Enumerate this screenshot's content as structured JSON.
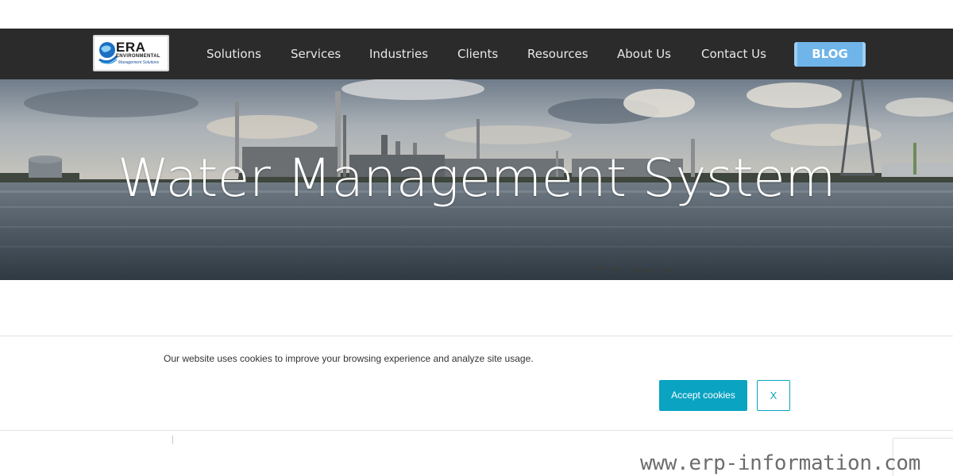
{
  "header": {
    "logo": {
      "name": "ERA",
      "line2": "ENVIRONMENTAL",
      "line3": "Management Solutions",
      "globe_icon": "globe-swoosh-icon"
    },
    "nav": [
      {
        "label": "Solutions"
      },
      {
        "label": "Services"
      },
      {
        "label": "Industries"
      },
      {
        "label": "Clients"
      },
      {
        "label": "Resources"
      },
      {
        "label": "About Us"
      },
      {
        "label": "Contact Us"
      }
    ],
    "blog_label": "BLOG"
  },
  "hero": {
    "title": "Water Management System"
  },
  "cookie_banner": {
    "message": "Our website uses cookies to improve your browsing experience and analyze site usage.",
    "accept_label": "Accept cookies",
    "close_label": "X"
  },
  "watermark": "www.erp-information.com",
  "colors": {
    "nav_background": "#2b2b2b",
    "blog_button": "#6fb5ea",
    "accent": "#0aa3c2",
    "hero_text": "#ffffff"
  }
}
